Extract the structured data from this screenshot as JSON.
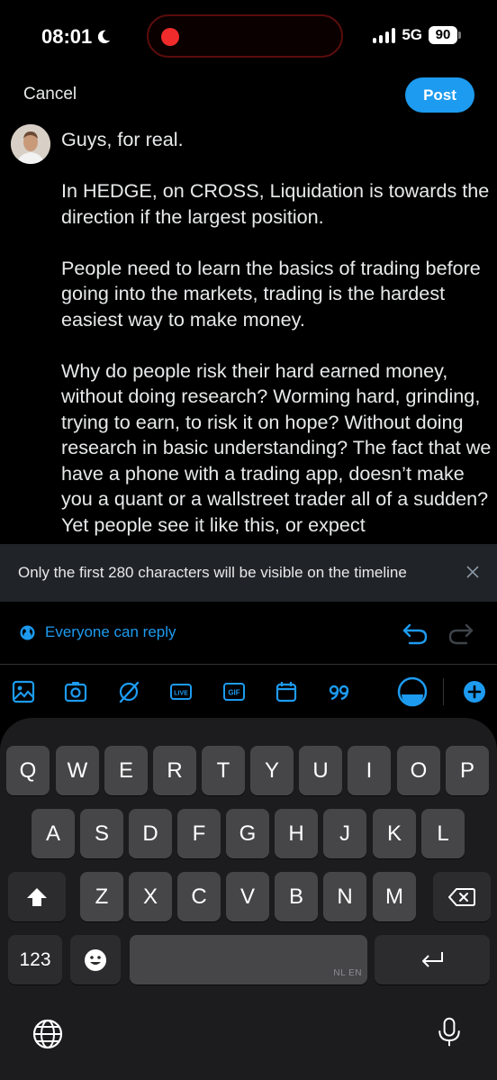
{
  "status_bar": {
    "time": "08:01",
    "network": "5G",
    "battery": "90"
  },
  "header": {
    "cancel_label": "Cancel",
    "post_label": "Post"
  },
  "composer": {
    "paragraphs": [
      "Guys, for real.",
      "In HEDGE, on CROSS, Liquidation is towards the direction if the largest position.",
      "People need to learn the basics of trading before going into the markets, trading is the hardest easiest way to make money.",
      "Why do people risk their hard earned money, without doing research? Worming hard, grinding, trying to earn, to risk it on hope? Without doing research in basic understanding? The fact that we have a phone with a trading app, doesn’t make you a quant or a wallstreet trader all of a sudden? Yet people see it like this, or expect"
    ]
  },
  "notice": {
    "text": "Only the first 280 characters will be visible on the timeline"
  },
  "reply": {
    "label": "Everyone can reply"
  },
  "toolbar": {
    "live_label": "LIVE",
    "gif_label": "GIF"
  },
  "keyboard": {
    "row1": [
      "Q",
      "W",
      "E",
      "R",
      "T",
      "Y",
      "U",
      "I",
      "O",
      "P"
    ],
    "row2": [
      "A",
      "S",
      "D",
      "F",
      "G",
      "H",
      "J",
      "K",
      "L"
    ],
    "row3": [
      "Z",
      "X",
      "C",
      "V",
      "B",
      "N",
      "M"
    ],
    "numbers_label": "123",
    "space_hint": "NL EN"
  },
  "colors": {
    "accent": "#1d9bf0",
    "background": "#000000",
    "notice_bg": "#202327",
    "keyboard_bg": "#1c1c1e",
    "key_bg": "#464648",
    "record": "#ef2b2b"
  }
}
